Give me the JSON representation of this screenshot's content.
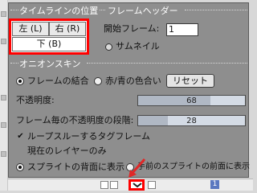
{
  "timeline_position": {
    "section_title": "タイムラインの位置",
    "left_label": "左 (L)",
    "right_label": "右 (R)",
    "bottom_label": "下 (B)"
  },
  "frame_header": {
    "section_title": "フレームヘッダー",
    "start_frame_label": "開始フレーム:",
    "start_frame_value": "1",
    "thumbnail_label": "サムネイル"
  },
  "onion_skin": {
    "section_title": "オニオンスキン",
    "blend_frames_label": "フレームの結合",
    "red_blue_label": "赤/青の色合い",
    "reset_label": "リセット",
    "opacity_label": "不透明度:",
    "opacity_value": "68",
    "opacity_fraction": 0.68,
    "opacity_step_label": "フレーム毎の不透明度の段階:",
    "opacity_step_value": "28",
    "opacity_step_fraction": 0.28,
    "loop_label": "ループスルーするタグフレーム",
    "current_layer_label": "現在のレイヤーのみ",
    "behind_sprites_label": "スプライトの背面に表示",
    "front_sprites_label": "手前のスプライトの前面に表示"
  },
  "layer_strip": {
    "layer_number": "1"
  },
  "colors": {
    "panel": "#8e8e8e",
    "highlight": "#ff0000",
    "arrow": "#e02828"
  }
}
